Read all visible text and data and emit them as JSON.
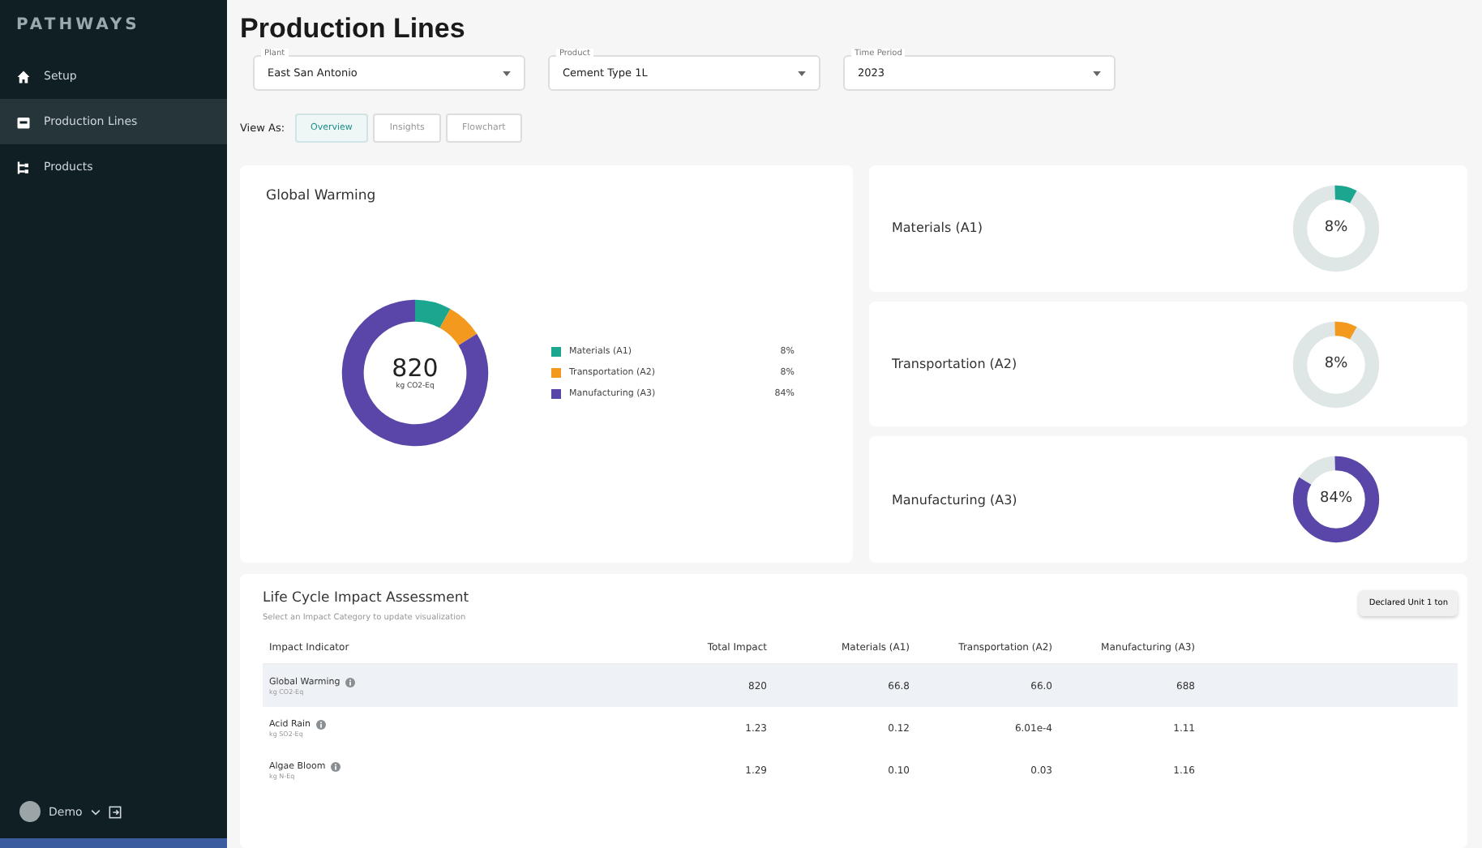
{
  "sidebar": {
    "logo": "PATHWAYS",
    "items": [
      {
        "label": "Setup",
        "selected": false
      },
      {
        "label": "Production Lines",
        "selected": true
      },
      {
        "label": "Products",
        "selected": false
      }
    ],
    "user": {
      "name": "Demo"
    }
  },
  "page_title": "Production Lines",
  "filters": [
    {
      "label": "Plant",
      "value": "East San Antonio"
    },
    {
      "label": "Product",
      "value": "Cement Type 1L"
    },
    {
      "label": "Time Period",
      "value": "2023"
    }
  ],
  "view_as": {
    "label": "View As:",
    "tabs": [
      {
        "label": "Overview",
        "selected": true
      },
      {
        "label": "Insights",
        "selected": false
      },
      {
        "label": "Flowchart",
        "selected": false
      }
    ]
  },
  "global_warming": {
    "title": "Global Warming",
    "total": "820",
    "unit": "kg CO2-Eq",
    "chart_data": {
      "type": "donut",
      "categories": [
        "Materials (A1)",
        "Transportation (A2)",
        "Manufacturing (A3)"
      ],
      "values": [
        8,
        8,
        84
      ]
    },
    "legend": [
      {
        "value": "8%",
        "color": "#1aa68f"
      },
      {
        "value": "8%",
        "color": "#f39a1e"
      },
      {
        "value": "84%",
        "color": "#5a46a8"
      }
    ]
  },
  "stage_cards": [
    {
      "title": "Materials (A1)",
      "reading": "8%",
      "level": 0.08,
      "color": "#1aa68f"
    },
    {
      "title": "Transportation (A2)",
      "reading": "8%",
      "level": 0.08,
      "color": "#f39a1e"
    },
    {
      "title": "Manufacturing (A3)",
      "reading": "84%",
      "level": 0.84,
      "color": "#5a46a8"
    }
  ],
  "assessment": {
    "title": "Life Cycle Impact Assessment",
    "subtitle": "Select an Impact Category to update visualization",
    "button": "Declared Unit 1 ton",
    "columns": [
      "Impact Indicator",
      "Total Impact",
      "Materials (A1)",
      "Transportation (A2)",
      "Manufacturing (A3)"
    ],
    "rows": [
      {
        "unit": "kg CO2-Eq",
        "cells": [
          "Global Warming",
          "820",
          "66.8",
          "66.0",
          "688"
        ],
        "selected": true
      },
      {
        "unit": "kg SO2-Eq",
        "cells": [
          "Acid Rain",
          "1.23",
          "0.12",
          "6.01e-4",
          "1.11"
        ],
        "selected": false
      },
      {
        "unit": "kg N-Eq",
        "cells": [
          "Algae Bloom",
          "1.29",
          "0.10",
          "0.03",
          "1.16"
        ],
        "selected": false
      }
    ]
  }
}
